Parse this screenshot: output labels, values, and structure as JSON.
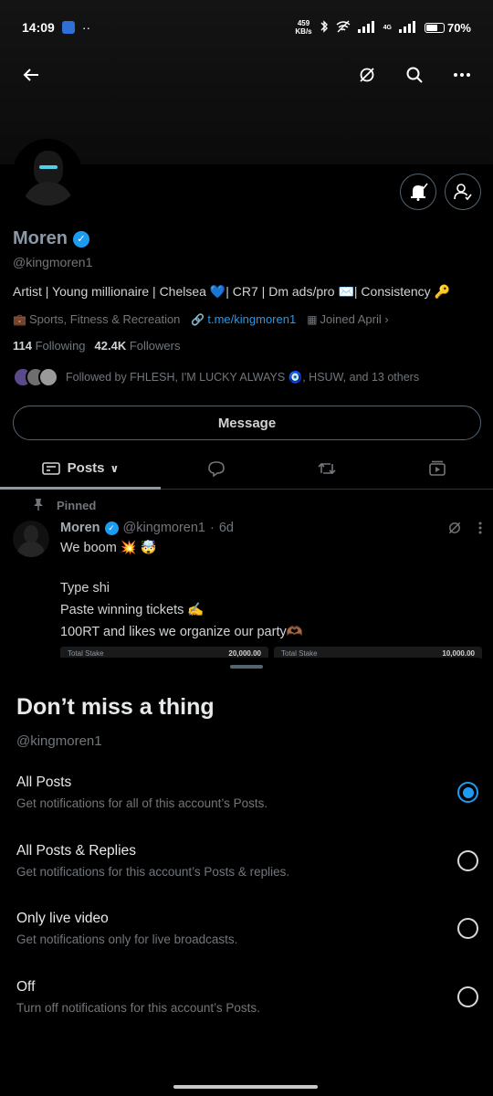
{
  "status_bar": {
    "time": "14:09",
    "dots": "··",
    "net_speed_value": "459",
    "net_speed_unit": "KB/s",
    "network": "4G",
    "battery_percent": "70%",
    "battery_level": 0.7
  },
  "profile": {
    "name": "Moren",
    "handle": "@kingmoren1",
    "bio": "Artist | Young millionaire | Chelsea 💙| CR7 | Dm ads/pro ✉️| Consistency 🔑",
    "category": "Sports, Fitness & Recreation",
    "link": "t.me/kingmoren1",
    "joined": "Joined April",
    "following_count": "114",
    "following_label": "Following",
    "followers_count": "42.4K",
    "followers_label": "Followers",
    "followed_by": "Followed by FHLESH, I'M LUCKY ALWAYS 🧿, HSUW, and 13 others",
    "message_button": "Message"
  },
  "tabs": {
    "posts": "Posts"
  },
  "pinned_post": {
    "pinned_label": "Pinned",
    "author_name": "Moren",
    "author_handle": "@kingmoren1",
    "separator": "·",
    "age": "6d",
    "line1": "We boom 💥 🤯",
    "line2": "Type shi",
    "line3": "Paste winning tickets ✍️",
    "line4": "100RT and likes we organize our party🫶🏾",
    "stake1_label": "Total Stake",
    "stake1_value": "20,000.00",
    "stake2_label": "Total Stake",
    "stake2_value": "10,000.00"
  },
  "sheet": {
    "title": "Don’t miss a thing",
    "subtitle": "@kingmoren1",
    "options": [
      {
        "title": "All Posts",
        "desc": "Get notifications for all of this account’s Posts.",
        "selected": true
      },
      {
        "title": "All Posts & Replies",
        "desc": "Get notifications for this account’s Posts & replies.",
        "selected": false
      },
      {
        "title": "Only live video",
        "desc": "Get notifications only for live broadcasts.",
        "selected": false
      },
      {
        "title": "Off",
        "desc": "Turn off notifications for this account’s Posts.",
        "selected": false
      }
    ]
  },
  "colors": {
    "accent": "#1d9bf0",
    "background": "#000000",
    "secondary_text": "#71767b"
  },
  "icons": {
    "back": "arrow-left-icon",
    "grok": "grok-icon",
    "search": "search-icon",
    "more": "more-icon",
    "bell": "bell-icon",
    "follow": "user-check-icon"
  }
}
